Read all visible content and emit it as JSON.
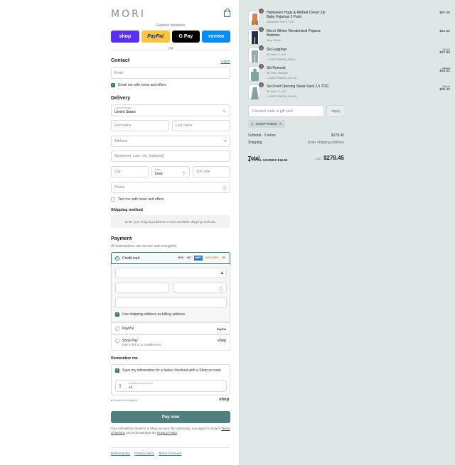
{
  "brand": {
    "logo": "MORI"
  },
  "checkout": {
    "express": "Express checkout",
    "or": "OR",
    "pay_buttons": [
      "shop",
      "PayPal",
      "G Pay",
      "venmo"
    ]
  },
  "contact": {
    "heading": "Contact",
    "login": "Log in",
    "email_placeholder": "Email",
    "email_opt": "Email me with news and offers"
  },
  "delivery": {
    "heading": "Delivery",
    "country_label": "Country/Region",
    "country": "United States",
    "first": "First name",
    "last": "Last name",
    "address": "Address",
    "apt": "Apartment, suite, etc. (optional)",
    "city": "City",
    "state_label": "State",
    "state": "Iowa",
    "zip": "ZIP code",
    "phone": "Phone",
    "text_opt": "Text me with news and offers"
  },
  "shipping": {
    "heading": "Shipping method",
    "note": "Enter your shipping address to view available shipping methods."
  },
  "payment": {
    "heading": "Payment",
    "subtitle": "All transactions are secure and encrypted.",
    "credit": "Credit card",
    "card_logos": [
      "VISA",
      "MC",
      "AMEX",
      "DISCOVER",
      "+5"
    ],
    "billing": "Use shipping address as billing address",
    "paypal": "PayPal",
    "paypal_logo": "PayPal",
    "shoppay": "Shop Pay",
    "shoppay_sub": "Pay in full or in installments",
    "shoppay_logo": "shop"
  },
  "remember": {
    "heading": "Remember me",
    "save": "Save my information for a faster checkout with a Shop account",
    "mobile_label": "Mobile phone number",
    "mobile_val": "+1",
    "secure": "Secure and encrypted",
    "shop": "shop"
  },
  "paynow": "Pay now",
  "legal": {
    "text": "Your info will be saved to a Shop account. By continuing, you agree to Shop's",
    "tos": "Terms of Service",
    "and": " and acknowledge the ",
    "privacy": "Privacy Policy",
    "end": "."
  },
  "footer": [
    "Refund policy",
    "Privacy policy",
    "Terms of service"
  ],
  "cart": {
    "items": [
      {
        "qty": "1",
        "name": "Halloween Hugs & Ribbed Clever Zip Baby Pajamas 2 Pack",
        "variant": "Halloween Print / 0 - 3 M",
        "price": "$87.00",
        "was": ""
      },
      {
        "qty": "1",
        "name": "Men's Winter Wonderland Pajama Bottoms",
        "variant": "Navy / Small",
        "price": "$51.50",
        "was": ""
      },
      {
        "qty": "1",
        "name": "Ski Leggings",
        "variant": "Ski Print / 3 - 6 M",
        "code": "SLEEPTIME20 (-$8.50)",
        "price": "$27.55",
        "was": "$36.05"
      },
      {
        "qty": "1",
        "name": "Ski Romsuit",
        "variant": "Ski Print / Newborn",
        "code": "SLEEPTIME20 (-$21.00)",
        "price": "$63.00",
        "was": "$84.00"
      },
      {
        "qty": "1",
        "name": "Ski Front Opening Sleep Sack 2.5 TOG",
        "variant": "Ski Print / 0 - 6 M",
        "code": "SLEEPTIME20 (-$16.60)",
        "price": "$59.40",
        "was": "$89.00"
      }
    ],
    "discount_placeholder": "Discount code or gift card",
    "apply": "Apply",
    "tag": "SLEEPTIME20",
    "subtotal_label": "Subtotal · 5 items",
    "subtotal": "$278.45",
    "shipping_label": "Shipping",
    "shipping": "Enter shipping address",
    "total_label": "Total",
    "currency": "USD",
    "total": "$278.45",
    "savings_label": "TOTAL SAVINGS",
    "savings": "$15.55"
  }
}
